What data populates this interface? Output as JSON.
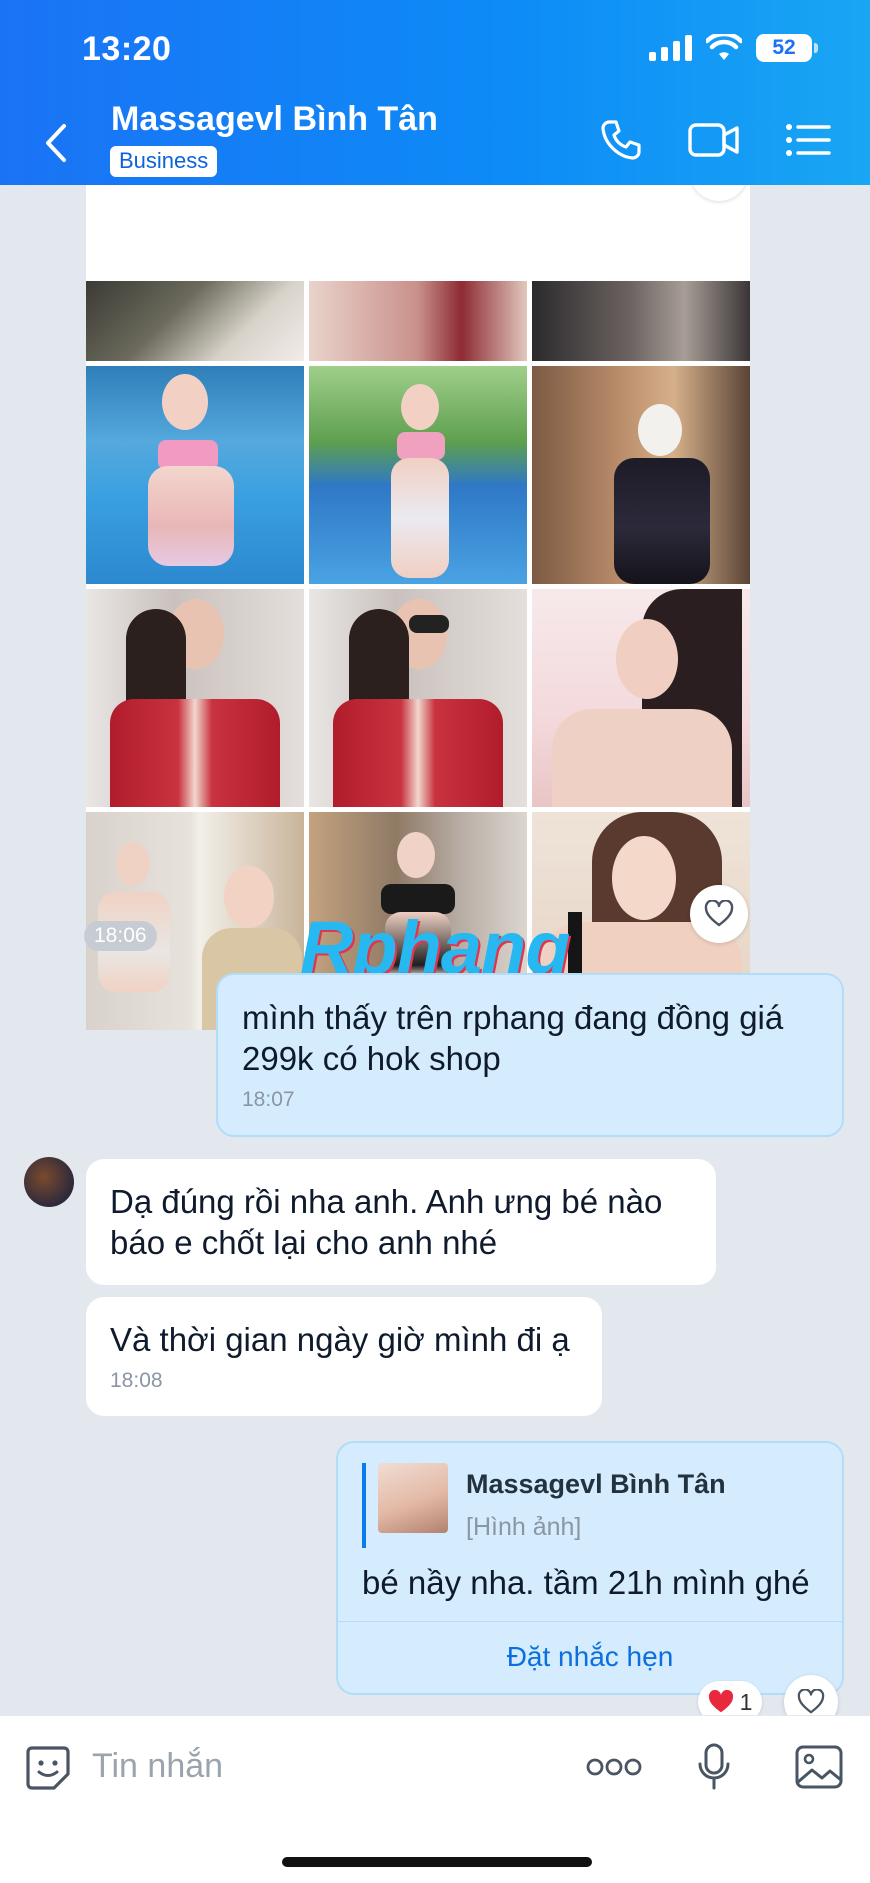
{
  "status": {
    "time": "13:20",
    "battery": "52"
  },
  "header": {
    "title": "Massagevl Bình Tân",
    "badge": "Business"
  },
  "messages": {
    "photos_time": "18:06",
    "watermark": "Rphang",
    "outgoing_1": {
      "text": "mình thấy trên rphang đang đồng giá 299k có hok shop",
      "time": "18:07"
    },
    "incoming_1": {
      "text": "Dạ đúng rồi nha anh. Anh ưng bé nào báo e chốt lại cho anh nhé"
    },
    "incoming_2": {
      "text": "Và thời gian ngày giờ mình đi ạ",
      "time": "18:08"
    },
    "outgoing_2": {
      "quote_name": "Massagevl Bình Tân",
      "quote_type": "[Hình ảnh]",
      "text": "bé nầy nha. tầm 21h mình ghé",
      "action": "Đặt nhắc hẹn",
      "reaction_count": "1"
    }
  },
  "input": {
    "placeholder": "Tin nhắn"
  },
  "icons": {
    "back": "chevron-left-icon",
    "call": "phone-icon",
    "video": "video-camera-icon",
    "menu": "list-menu-icon",
    "sticker": "sticker-smile-icon",
    "more": "more-dots-icon",
    "mic": "microphone-icon",
    "image": "image-icon",
    "heart": "heart-outline-icon"
  },
  "colors": {
    "header_start": "#1a73f5",
    "header_end": "#19a6f4",
    "out_bubble": "#d4ecfd",
    "link": "#0b6fe0"
  }
}
